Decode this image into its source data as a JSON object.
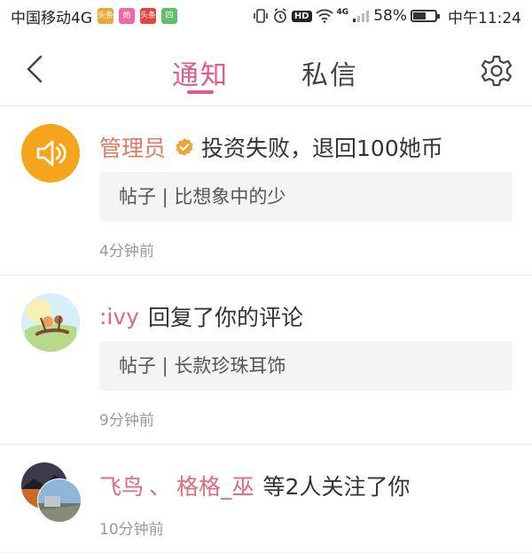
{
  "status_bar": {
    "carrier": "中国移动4G",
    "app_icons": [
      {
        "name": "news-app-icon",
        "label": "头条",
        "color": "#e8a93a"
      },
      {
        "name": "ta-app-icon",
        "label": "她",
        "color": "#f06aa0"
      },
      {
        "name": "toutiao-app-icon",
        "label": "头条",
        "color": "#e64340"
      },
      {
        "name": "green-app-icon",
        "label": "四",
        "color": "#5fbf6a"
      }
    ],
    "network_badge": "HD",
    "network_type": "4G",
    "battery_percent": "58%",
    "battery_level": 0.58,
    "time": "中午11:24"
  },
  "nav": {
    "tabs": [
      {
        "label": "通知",
        "active": true
      },
      {
        "label": "私信",
        "active": false
      }
    ],
    "accent_color": "#e05a8a"
  },
  "notifications": [
    {
      "name": "管理员",
      "verified": true,
      "message": "投资失败，退回100她币",
      "quote": "帖子 | 比想象中的少",
      "time": "4分钟前",
      "avatar": "speaker-icon"
    },
    {
      "name": ":ivy",
      "message": "回复了你的评论",
      "quote": "帖子 | 长款珍珠耳饰",
      "time": "9分钟前",
      "avatar": "user-avatar"
    },
    {
      "names": [
        "飞鸟",
        "格格_巫"
      ],
      "separator": "、",
      "message": "等2人关注了你",
      "time": "10分钟前",
      "avatar": "stacked-avatars"
    }
  ]
}
